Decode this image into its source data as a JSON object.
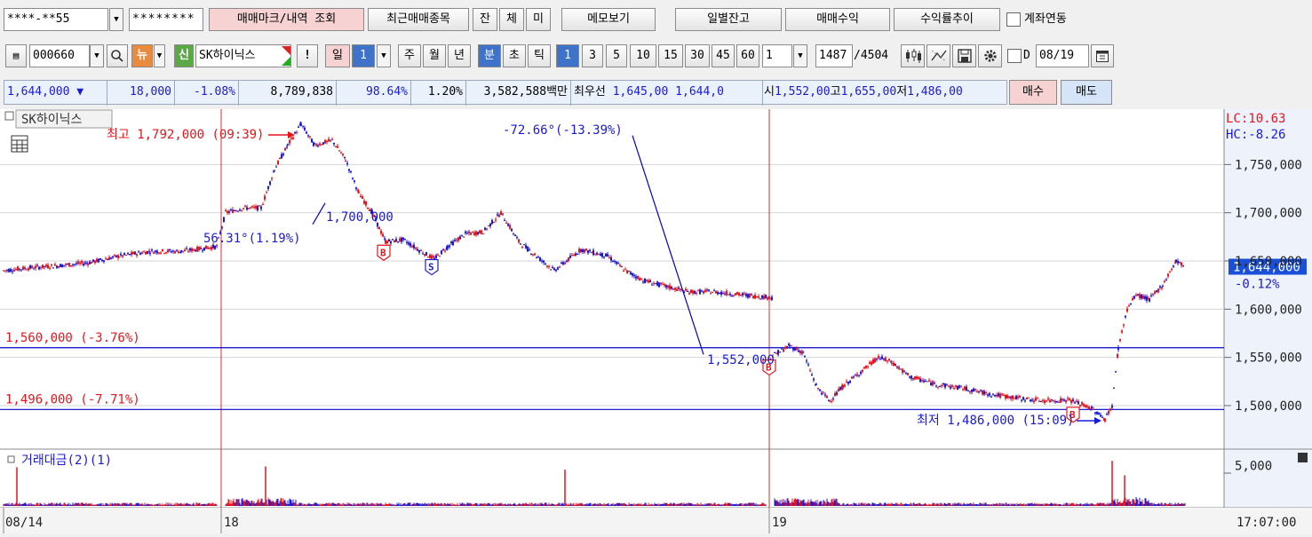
{
  "toolbar1": {
    "account_value": "****-**55",
    "password_value": "********",
    "trade_mark_button": "매매마크/내역 조회",
    "recent_items_button": "최근매매종목",
    "tab_jan": "잔",
    "tab_che": "체",
    "tab_mi": "미",
    "memo_button": "메모보기",
    "daily_balance_button": "일별잔고",
    "trade_profit_button": "매매수익",
    "return_trend_button": "수익률추이",
    "account_link_label": "계좌연동"
  },
  "toolbar2": {
    "code_value": "000660",
    "news_label": "뉴",
    "credit_label": "신",
    "stock_name": "SK하이닉스",
    "alert_label": "!",
    "period_day": "일",
    "period_day_count": "1",
    "period_week": "주",
    "period_month": "월",
    "period_year": "년",
    "period_minute": "분",
    "period_second": "초",
    "period_tick": "틱",
    "minute_options": [
      "1",
      "3",
      "5",
      "10",
      "15",
      "30",
      "45",
      "60"
    ],
    "unit_value": "1",
    "count_value": "1487",
    "count_total": "/4504",
    "date_checkbox_label": "D",
    "date_value": "08/19"
  },
  "quote": {
    "price": "1,644,000",
    "direction_symbol": "▼",
    "change": "18,000",
    "change_pct": "-1.08%",
    "volume": "8,789,838",
    "volume_ratio": "98.64%",
    "turnover_pct": "1.20%",
    "amount": "3,582,588백만",
    "best_label": "최우선",
    "best_ask": "1,645,00",
    "best_bid": "1,644,0",
    "open_label": "시",
    "open": "1,552,00",
    "high_label": "고",
    "high": "1,655,00",
    "low_label": "저",
    "low": "1,486,00",
    "buy_button": "매수",
    "sell_button": "매도"
  },
  "colors": {
    "up": "#e8141a",
    "down": "#1a1ad8",
    "level_line": "#0000c8",
    "session_line": "#d23030"
  },
  "chart_data": {
    "type": "candlestick",
    "title": "SK하이닉스",
    "interval": "1 minute",
    "y_ticks": [
      "1,750,000",
      "1,700,000",
      "1,650,000",
      "1,600,000",
      "1,550,000",
      "1,500,000"
    ],
    "y_tick_values": [
      1750000,
      1700000,
      1650000,
      1600000,
      1550000,
      1500000
    ],
    "ylim": [
      1465000,
      1800000
    ],
    "x_tick_labels": [
      "08/14",
      "18",
      "19"
    ],
    "time_readout": "17:07:00",
    "current_price_label": "1,644,000",
    "current_change_label": "-0.12%",
    "lc_label": "LC:10.63",
    "hc_label": "HC:-8.26",
    "high_annotation": "최고 1,792,000 (09:39)",
    "low_annotation": "최저 1,486,000 (15:09)",
    "trend_lines": [
      {
        "label": "56.31°(1.19%)",
        "end_label": "1,700,000"
      },
      {
        "label": "-72.66°(-13.39%)",
        "end_label": "1,552,000"
      }
    ],
    "levels": [
      {
        "value": 1560000,
        "label": "1,560,000 (-3.76%)"
      },
      {
        "value": 1496000,
        "label": "1,496,000 (-7.71%)"
      }
    ],
    "markers": [
      {
        "type": "B",
        "price": 1670000
      },
      {
        "type": "S",
        "price": 1655000
      },
      {
        "type": "B",
        "price": 1551000
      },
      {
        "type": "B",
        "price": 1502000
      }
    ],
    "path_points": [
      {
        "t": 0,
        "p": 1640000
      },
      {
        "t": 30,
        "p": 1643000
      },
      {
        "t": 60,
        "p": 1645000
      },
      {
        "t": 95,
        "p": 1648000
      },
      {
        "t": 130,
        "p": 1655000
      },
      {
        "t": 165,
        "p": 1660000
      },
      {
        "t": 200,
        "p": 1660000
      },
      {
        "t": 240,
        "p": 1665000
      },
      {
        "t": 250,
        "p": 1700000
      },
      {
        "t": 270,
        "p": 1705000
      },
      {
        "t": 290,
        "p": 1705000
      },
      {
        "t": 305,
        "p": 1745000
      },
      {
        "t": 320,
        "p": 1770000
      },
      {
        "t": 335,
        "p": 1792000
      },
      {
        "t": 350,
        "p": 1770000
      },
      {
        "t": 370,
        "p": 1775000
      },
      {
        "t": 385,
        "p": 1755000
      },
      {
        "t": 400,
        "p": 1720000
      },
      {
        "t": 415,
        "p": 1700000
      },
      {
        "t": 430,
        "p": 1670000
      },
      {
        "t": 450,
        "p": 1672000
      },
      {
        "t": 470,
        "p": 1660000
      },
      {
        "t": 485,
        "p": 1652000
      },
      {
        "t": 500,
        "p": 1665000
      },
      {
        "t": 520,
        "p": 1678000
      },
      {
        "t": 540,
        "p": 1680000
      },
      {
        "t": 560,
        "p": 1700000
      },
      {
        "t": 580,
        "p": 1670000
      },
      {
        "t": 600,
        "p": 1655000
      },
      {
        "t": 620,
        "p": 1640000
      },
      {
        "t": 650,
        "p": 1662000
      },
      {
        "t": 680,
        "p": 1655000
      },
      {
        "t": 700,
        "p": 1640000
      },
      {
        "t": 720,
        "p": 1630000
      },
      {
        "t": 740,
        "p": 1625000
      },
      {
        "t": 770,
        "p": 1618000
      },
      {
        "t": 800,
        "p": 1618000
      },
      {
        "t": 830,
        "p": 1615000
      },
      {
        "t": 865,
        "p": 1612000
      },
      {
        "t": 866,
        "p": 1552000
      },
      {
        "t": 885,
        "p": 1562000
      },
      {
        "t": 900,
        "p": 1555000
      },
      {
        "t": 915,
        "p": 1520000
      },
      {
        "t": 930,
        "p": 1505000
      },
      {
        "t": 945,
        "p": 1520000
      },
      {
        "t": 965,
        "p": 1535000
      },
      {
        "t": 985,
        "p": 1550000
      },
      {
        "t": 1000,
        "p": 1545000
      },
      {
        "t": 1020,
        "p": 1530000
      },
      {
        "t": 1050,
        "p": 1522000
      },
      {
        "t": 1080,
        "p": 1518000
      },
      {
        "t": 1110,
        "p": 1512000
      },
      {
        "t": 1140,
        "p": 1508000
      },
      {
        "t": 1170,
        "p": 1505000
      },
      {
        "t": 1200,
        "p": 1506000
      },
      {
        "t": 1225,
        "p": 1497000
      },
      {
        "t": 1240,
        "p": 1486000
      },
      {
        "t": 1248,
        "p": 1500000
      },
      {
        "t": 1255,
        "p": 1560000
      },
      {
        "t": 1265,
        "p": 1600000
      },
      {
        "t": 1275,
        "p": 1615000
      },
      {
        "t": 1290,
        "p": 1610000
      },
      {
        "t": 1305,
        "p": 1625000
      },
      {
        "t": 1320,
        "p": 1650000
      },
      {
        "t": 1330,
        "p": 1644000
      }
    ],
    "volume_panel": {
      "title": "거래대금(2)(1)",
      "y_tick": "5,000",
      "y_tick_value": 5000,
      "ymax": 6500,
      "spikes": [
        {
          "t": 15,
          "v": 4800
        },
        {
          "t": 295,
          "v": 4900
        },
        {
          "t": 632,
          "v": 4500
        },
        {
          "t": 1248,
          "v": 5600
        },
        {
          "t": 1262,
          "v": 3800
        }
      ]
    }
  }
}
